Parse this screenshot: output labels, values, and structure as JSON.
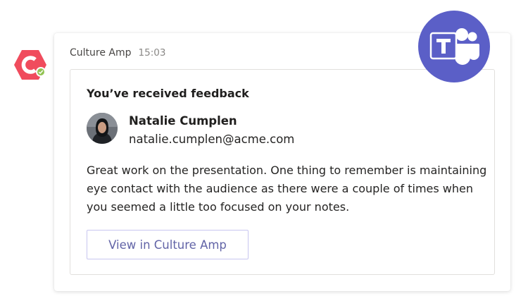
{
  "message": {
    "sender": "Culture Amp",
    "time": "15:03"
  },
  "card": {
    "title": "You’ve received feedback",
    "person": {
      "name": "Natalie Cumplen",
      "email": "natalie.cumplen@acme.com"
    },
    "feedback_text": "Great work on the presentation. One thing to remember is maintaining eye contact with the audience as there were a couple of times when you seemed a little too focused on your notes.",
    "button_label": "View in Culture Amp"
  },
  "icons": {
    "bot_avatar": "culture-amp-logo",
    "presence": "available-check",
    "app_logo": "microsoft-teams-logo"
  },
  "colors": {
    "culture_amp_brand": "#f04c5d",
    "teams_purple": "#5b5fc7",
    "button_text": "#6264a7",
    "presence_green": "#92c353"
  }
}
